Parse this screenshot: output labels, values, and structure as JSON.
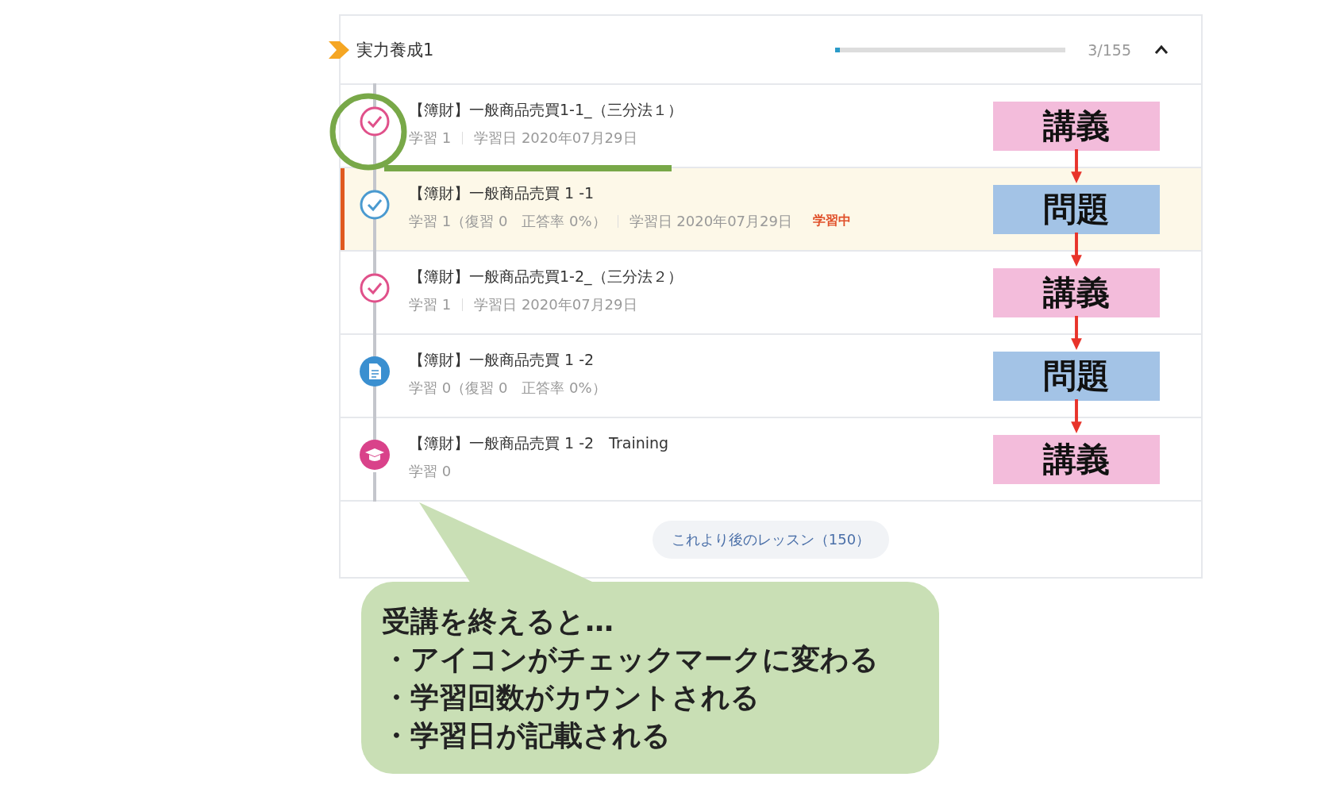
{
  "section": {
    "title": "実力養成1",
    "progress": {
      "level": 0.02,
      "reading": "3/155"
    },
    "expanded": true
  },
  "lessons": [
    {
      "title": "【簿財】一般商品売買1-1_（三分法１）",
      "kind": "lecture",
      "completed": true,
      "meta": [
        "学習 1",
        "学習日 2020年07月29日"
      ],
      "current": false,
      "tag": {
        "label": "講義",
        "kind": "lecture"
      }
    },
    {
      "title": "【簿財】一般商品売買 1 -1",
      "kind": "problem",
      "completed": true,
      "meta": [
        "学習 1（復習 0　正答率 0%）",
        "学習日 2020年07月29日"
      ],
      "current": true,
      "status": "学習中",
      "tag": {
        "label": "問題",
        "kind": "problem"
      }
    },
    {
      "title": "【簿財】一般商品売買1-2_（三分法２）",
      "kind": "lecture",
      "completed": true,
      "meta": [
        "学習 1",
        "学習日 2020年07月29日"
      ],
      "current": false,
      "tag": {
        "label": "講義",
        "kind": "lecture"
      }
    },
    {
      "title": "【簿財】一般商品売買 1 -2",
      "kind": "problem",
      "completed": false,
      "meta": [
        "学習 0（復習 0　正答率 0%）"
      ],
      "current": false,
      "tag": {
        "label": "問題",
        "kind": "problem"
      }
    },
    {
      "title": "【簿財】一般商品売買 1 -2　Training",
      "kind": "training",
      "completed": false,
      "meta": [
        "学習 0"
      ],
      "current": false,
      "tag": {
        "label": "講義",
        "kind": "lecture"
      }
    }
  ],
  "more_button": "これより後のレッスン（150）",
  "callout": {
    "lines": [
      "受講を終えると…",
      "・アイコンがチェックマークに変わる",
      "・学習回数がカウントされる",
      "・学習日が記載される"
    ]
  }
}
